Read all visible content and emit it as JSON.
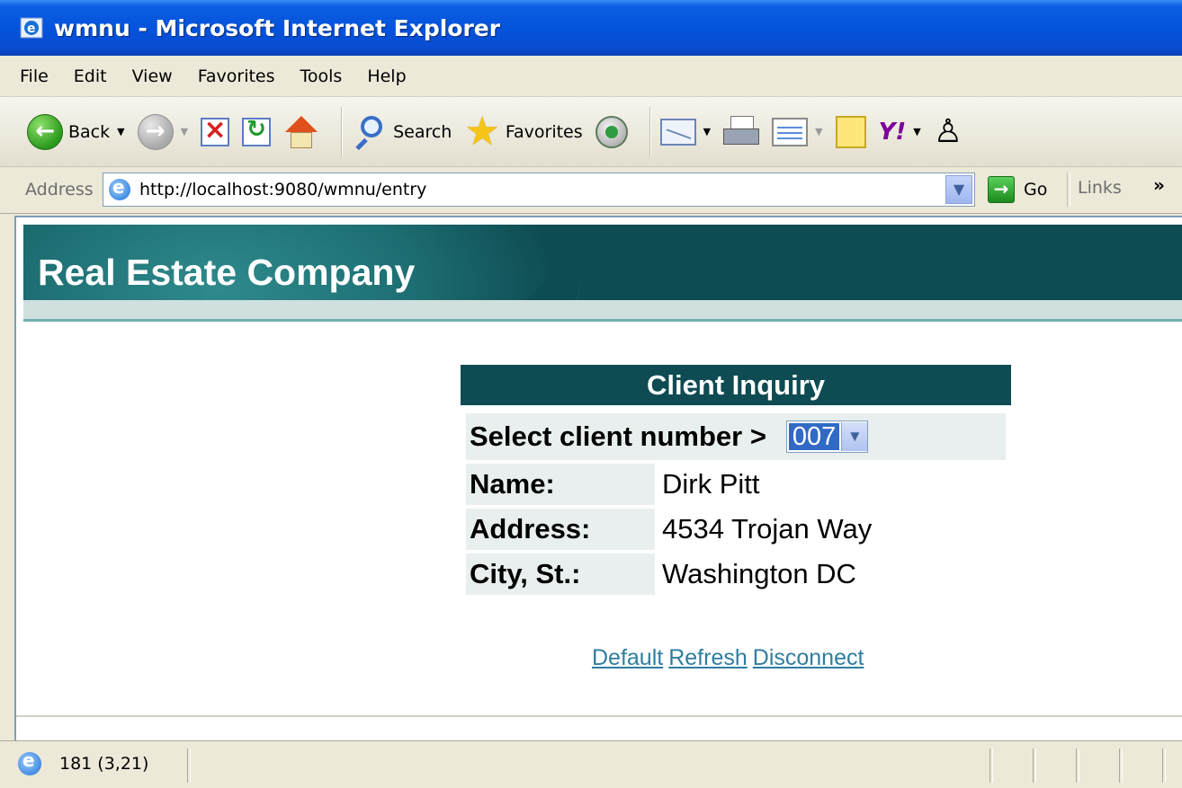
{
  "window": {
    "title": "wmnu - Microsoft Internet Explorer"
  },
  "menu": {
    "items": [
      "File",
      "Edit",
      "View",
      "Favorites",
      "Tools",
      "Help"
    ]
  },
  "toolbar": {
    "back_label": "Back",
    "search_label": "Search",
    "favorites_label": "Favorites"
  },
  "address": {
    "label": "Address",
    "url": "http://localhost:9080/wmnu/entry",
    "go_label": "Go",
    "links_label": "Links",
    "more": "»"
  },
  "page": {
    "banner_title": "Real Estate Company",
    "inquiry": {
      "header": "Client Inquiry",
      "select_label": "Select client number >",
      "selected_client": "007",
      "name_label": "Name:",
      "name_value": "Dirk Pitt",
      "address_label": "Address:",
      "address_value": "4534 Trojan Way",
      "city_label": "City, St.:",
      "city_value": "Washington DC"
    },
    "links": {
      "default": "Default",
      "refresh": "Refresh",
      "disconnect": "Disconnect"
    }
  },
  "status": {
    "text": "181 (3,21)"
  },
  "colors": {
    "banner": "#0e4b52",
    "link": "#2f7ea0",
    "selection": "#316ac5"
  }
}
